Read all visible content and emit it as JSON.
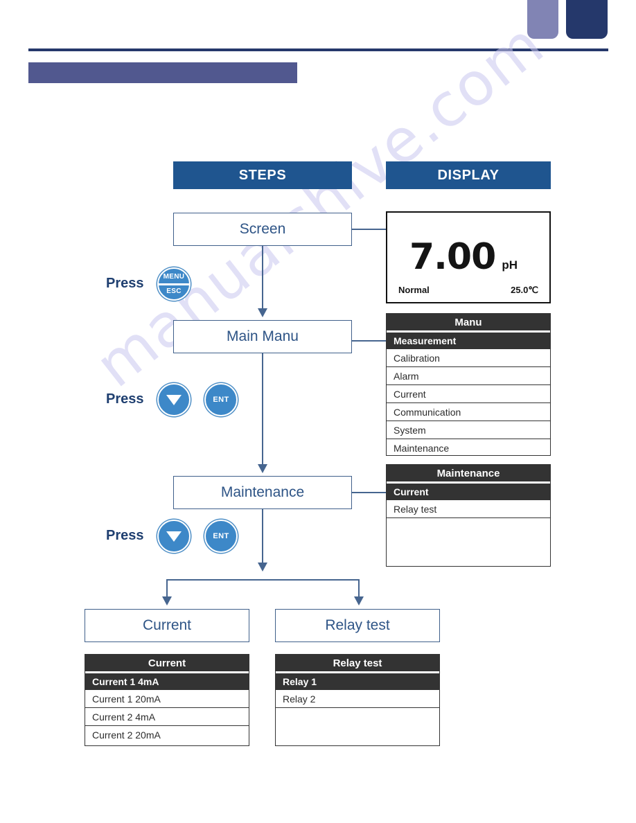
{
  "page": {
    "watermark": "manualshive.com"
  },
  "headers": {
    "steps": "STEPS",
    "display": "DISPLAY"
  },
  "flow": {
    "screen": "Screen",
    "main_manu": "Main Manu",
    "maintenance": "Maintenance",
    "current": "Current",
    "relay_test": "Relay test"
  },
  "press": {
    "label_1": "Press",
    "label_2": "Press",
    "label_3": "Press"
  },
  "buttons": {
    "menu": "MENU",
    "esc": "ESC",
    "ent": "ENT"
  },
  "lcd_measure": {
    "value": "7.00",
    "unit": "pH",
    "status": "Normal",
    "temperature": "25.0℃"
  },
  "lcd_manu": {
    "title": "Manu",
    "items": [
      {
        "label": "Measurement",
        "selected": true
      },
      {
        "label": "Calibration",
        "selected": false
      },
      {
        "label": "Alarm",
        "selected": false
      },
      {
        "label": "Current",
        "selected": false
      },
      {
        "label": "Communication",
        "selected": false
      },
      {
        "label": "System",
        "selected": false
      },
      {
        "label": "Maintenance",
        "selected": false
      }
    ]
  },
  "lcd_maintenance": {
    "title": "Maintenance",
    "items": [
      {
        "label": "Current",
        "selected": true
      },
      {
        "label": "Relay test",
        "selected": false
      }
    ]
  },
  "lcd_current": {
    "title": "Current",
    "items": [
      {
        "label": "Current 1 4mA",
        "selected": true
      },
      {
        "label": "Current 1 20mA",
        "selected": false
      },
      {
        "label": "Current 2 4mA",
        "selected": false
      },
      {
        "label": "Current 2 20mA",
        "selected": false
      }
    ]
  },
  "lcd_relay": {
    "title": "Relay test",
    "items": [
      {
        "label": "Relay 1",
        "selected": true
      },
      {
        "label": "Relay 2",
        "selected": false
      }
    ]
  },
  "colors": {
    "header_blue": "#1f558f",
    "navy_tab": "#25386b",
    "lavender_tab": "#8184b4",
    "title_band": "#51588f",
    "box_border": "#3f5f8a",
    "box_text": "#2e5486",
    "button_blue": "#3d88c8",
    "lcd_dark": "#333333",
    "watermark": "#c9c7ef"
  }
}
